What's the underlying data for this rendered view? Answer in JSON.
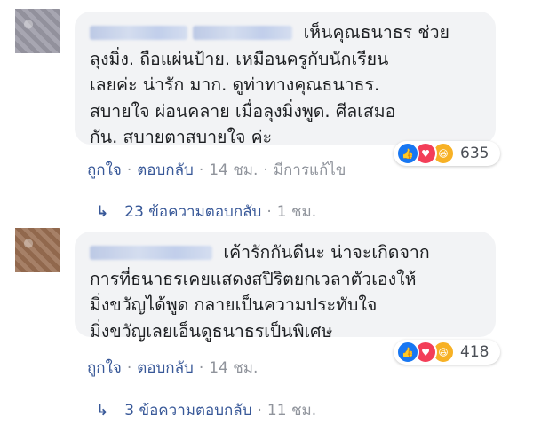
{
  "comments": [
    {
      "text": "เห็นคุณธนาธร ช่วย\nลุงมิ่ง. ถือแผ่นป้าย. เหมือนครูกับนักเรียน\nเลยค่ะ น่ารัก มาก. ดูท่าทางคุณธนาธร.\nสบายใจ ผ่อนคลาย เมื่อลุงมิ่งพูด. ศีลเสมอ\nกัน. สบายตาสบายใจ ค่ะ",
      "reactions": {
        "icons": [
          "like-icon",
          "love-icon",
          "haha-icon"
        ],
        "count": "635"
      },
      "actions": {
        "like": "ถูกใจ",
        "reply": "ตอบกลับ",
        "time": "14 ชม.",
        "edited": "มีการแก้ไข"
      },
      "replies": {
        "label": "23 ข้อความตอบกลับ",
        "time": "1 ชม."
      }
    },
    {
      "text": "เค้ารักกันดีนะ น่าจะเกิดจาก\nการที่ธนาธรเคยแสดงสปิริตยกเวลาตัวเองให้\nมิ่งขวัญได้พูด กลายเป็นความประทับใจ\nมิ่งขวัญเลยเอ็นดูธนาธรเป็นพิเศษ",
      "reactions": {
        "icons": [
          "like-icon",
          "love-icon",
          "haha-icon"
        ],
        "count": "418"
      },
      "actions": {
        "like": "ถูกใจ",
        "reply": "ตอบกลับ",
        "time": "14 ชม."
      },
      "replies": {
        "label": "3 ข้อความตอบกลับ",
        "time": "11 ชม."
      }
    }
  ],
  "colors": {
    "link": "#385898",
    "meta": "#90949c",
    "bubble": "#f2f3f5",
    "like": "#1877f2",
    "love": "#f33e58",
    "haha": "#f7b125"
  }
}
